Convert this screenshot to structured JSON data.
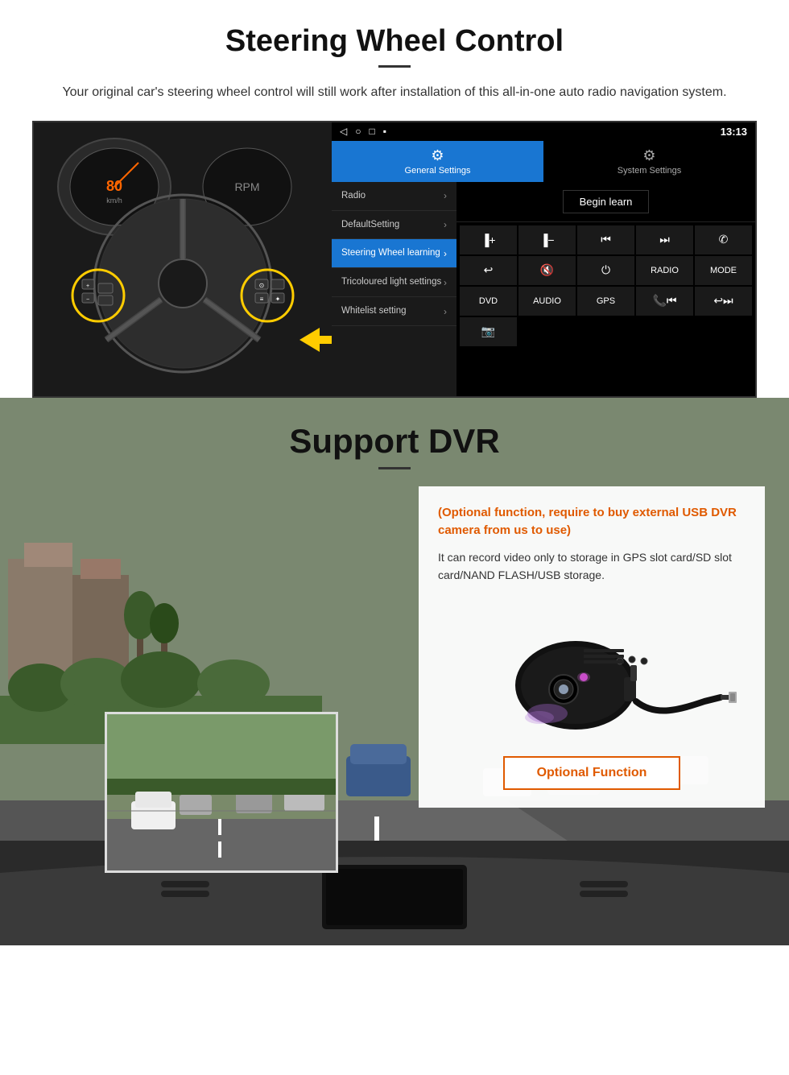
{
  "section1": {
    "title": "Steering Wheel Control",
    "subtitle": "Your original car's steering wheel control will still work after installation of this all-in-one auto radio navigation system.",
    "statusbar": {
      "time": "13:13",
      "icons_left": [
        "◁",
        "○",
        "□",
        "■"
      ],
      "icons_right": "♥ ▾ 13:13"
    },
    "tabs": [
      {
        "label": "General Settings",
        "active": true,
        "icon": "⚙"
      },
      {
        "label": "System Settings",
        "active": false,
        "icon": "⚙"
      }
    ],
    "menu_items": [
      {
        "label": "Radio",
        "selected": false
      },
      {
        "label": "DefaultSetting",
        "selected": false
      },
      {
        "label": "Steering Wheel learning",
        "selected": true
      },
      {
        "label": "Tricoloured light settings",
        "selected": false
      },
      {
        "label": "Whitelist setting",
        "selected": false
      }
    ],
    "begin_learn_label": "Begin learn",
    "control_buttons": [
      {
        "label": "▐+",
        "type": "icon"
      },
      {
        "label": "▐−",
        "type": "icon"
      },
      {
        "label": "⏮",
        "type": "icon"
      },
      {
        "label": "⏭",
        "type": "icon"
      },
      {
        "label": "✆",
        "type": "icon"
      },
      {
        "label": "↩",
        "type": "icon"
      },
      {
        "label": "🔇×",
        "type": "icon"
      },
      {
        "label": "⏻",
        "type": "icon"
      },
      {
        "label": "RADIO",
        "type": "text"
      },
      {
        "label": "MODE",
        "type": "text"
      },
      {
        "label": "DVD",
        "type": "text"
      },
      {
        "label": "AUDIO",
        "type": "text"
      },
      {
        "label": "GPS",
        "type": "text"
      },
      {
        "label": "📞⏮",
        "type": "icon"
      },
      {
        "label": "↩⏭",
        "type": "icon"
      },
      {
        "label": "📷",
        "type": "icon"
      }
    ]
  },
  "section2": {
    "title": "Support DVR",
    "optional_text": "(Optional function, require to buy external USB DVR camera from us to use)",
    "description": "It can record video only to storage in GPS slot card/SD slot card/NAND FLASH/USB storage.",
    "optional_function_label": "Optional Function"
  }
}
